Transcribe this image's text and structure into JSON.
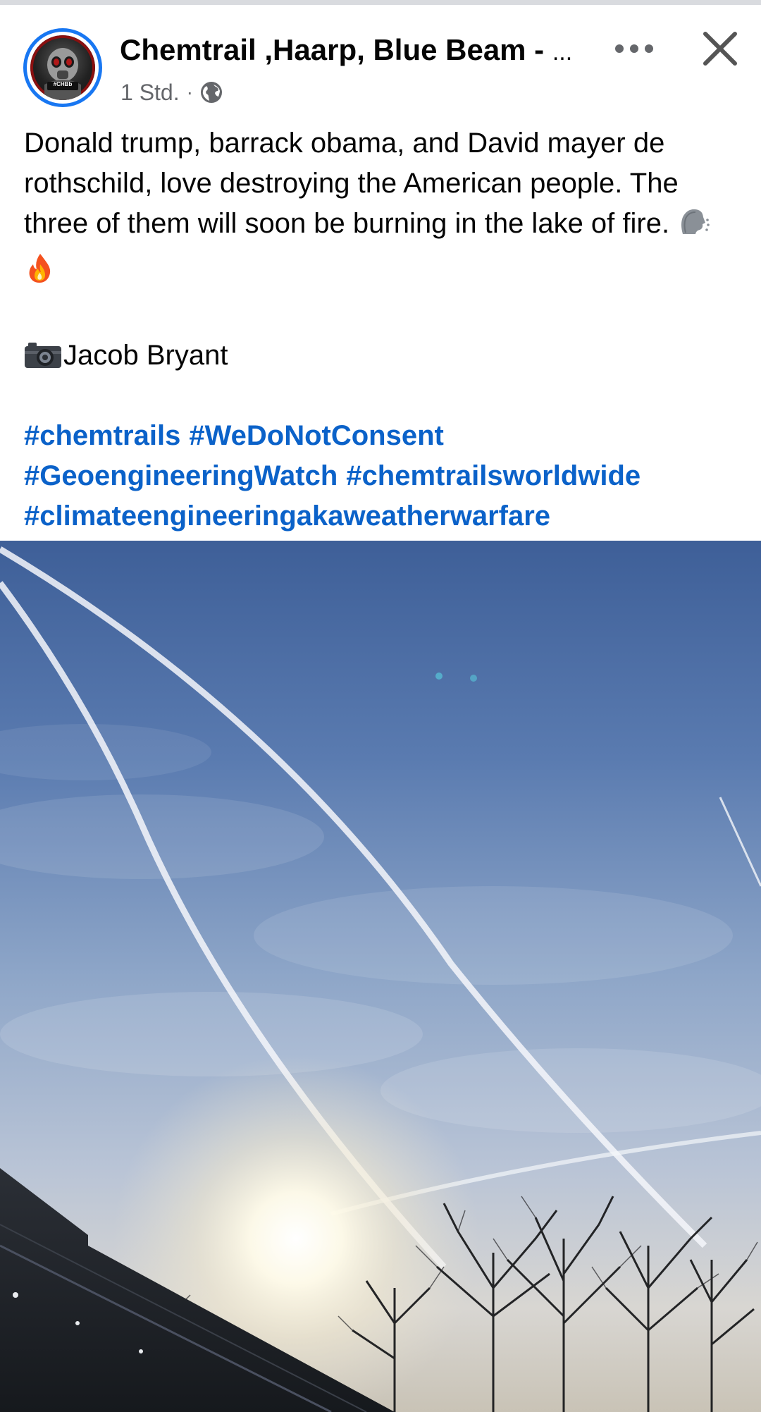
{
  "header": {
    "page_name": "Chemtrail ,Haarp, Blue Beam -",
    "ellipsis": "...",
    "time": "1 Std.",
    "separator": "·",
    "avatar_badge": "#CHBb"
  },
  "post": {
    "text_line": "Donald trump, barrack obama, and David mayer de rothschild, love destroying the American people. The three of them will soon be burning in the lake of fire.",
    "credit": "Jacob Bryant",
    "hashtags": [
      "#chemtrails",
      "#WeDoNotConsent",
      "#GeoengineeringWatch",
      "#chemtrailsworldwide",
      "#climateengineeringakaweatherwarfare"
    ]
  },
  "icons": {
    "more": "more-horizontal-icon",
    "close": "close-icon",
    "globe": "globe-icon",
    "camera": "camera-icon",
    "speaking_head": "speaking-head-emoji",
    "fire": "fire-emoji"
  },
  "colors": {
    "hashtag": "#0b62c9",
    "avatar_ring": "#1877f2",
    "meta_text": "#65676b"
  }
}
